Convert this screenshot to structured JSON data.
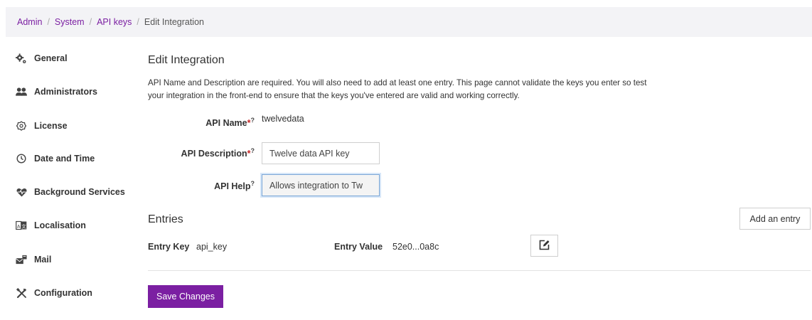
{
  "breadcrumb": {
    "items": [
      "Admin",
      "System",
      "API keys"
    ],
    "separator": "/",
    "current": "Edit Integration"
  },
  "sidebar": {
    "items": [
      {
        "label": "General",
        "icon": "gears-icon"
      },
      {
        "label": "Administrators",
        "icon": "users-icon"
      },
      {
        "label": "License",
        "icon": "certificate-icon"
      },
      {
        "label": "Date and Time",
        "icon": "clock-icon"
      },
      {
        "label": "Background Services",
        "icon": "heartbeat-icon"
      },
      {
        "label": "Localisation",
        "icon": "language-icon"
      },
      {
        "label": "Mail",
        "icon": "mail-bulk-icon"
      },
      {
        "label": "Configuration",
        "icon": "tools-icon"
      }
    ]
  },
  "page": {
    "title": "Edit Integration",
    "intro": "API Name and Description are required. You will also need to add at least one entry. This page cannot validate the keys you enter so test your integration in the front-end to ensure that the keys you've entered are valid and working correctly."
  },
  "form": {
    "required_mark": "*",
    "help_mark": "?",
    "api_name_label": "API Name",
    "api_name_value": "twelvedata",
    "api_description_label": "API Description",
    "api_description_value": "Twelve data API key",
    "api_help_label": "API Help",
    "api_help_value": "Allows integration to Tw"
  },
  "entries": {
    "title": "Entries",
    "add_label": "Add an entry",
    "rows": [
      {
        "key_label": "Entry Key",
        "key": "api_key",
        "value_label": "Entry Value",
        "value": "52e0...0a8c"
      }
    ]
  },
  "actions": {
    "save_label": "Save Changes"
  },
  "colors": {
    "accent": "#7b1fa2",
    "required": "#c62828"
  }
}
